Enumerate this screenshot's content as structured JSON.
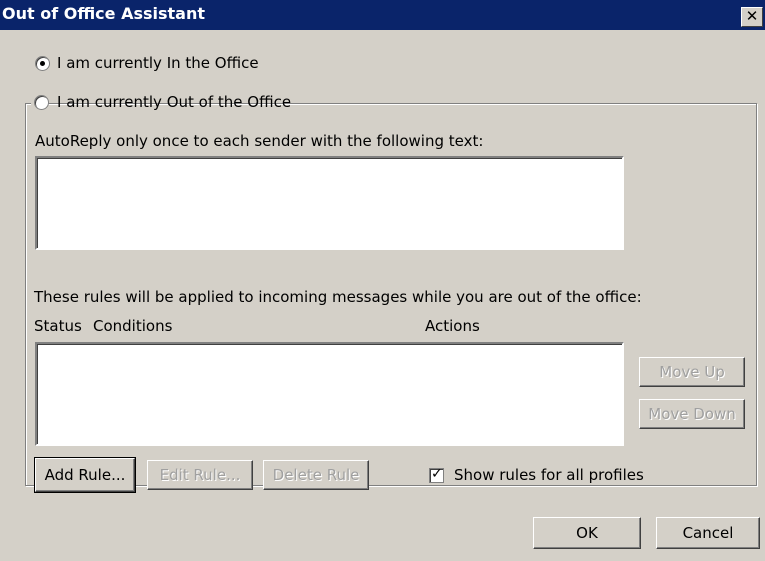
{
  "window": {
    "title": "Out of Office Assistant",
    "close_glyph": "✕"
  },
  "status": {
    "in_office_label": "I am currently In the Office",
    "out_office_label": "I am currently Out of the Office",
    "selected": "in_office"
  },
  "autoreply": {
    "label": "AutoReply only once to each sender with the following text:",
    "text": ""
  },
  "rules": {
    "description": "These rules will be applied to incoming messages while you are out of the office:",
    "columns": [
      "Status",
      "Conditions",
      "Actions"
    ],
    "items": [],
    "move_up_label": "Move Up",
    "move_down_label": "Move Down",
    "add_rule_label": "Add Rule...",
    "edit_rule_label": "Edit Rule...",
    "delete_rule_label": "Delete Rule",
    "show_all_profiles_label": "Show rules for all profiles",
    "show_all_profiles_checked": true
  },
  "footer": {
    "ok_label": "OK",
    "cancel_label": "Cancel"
  }
}
